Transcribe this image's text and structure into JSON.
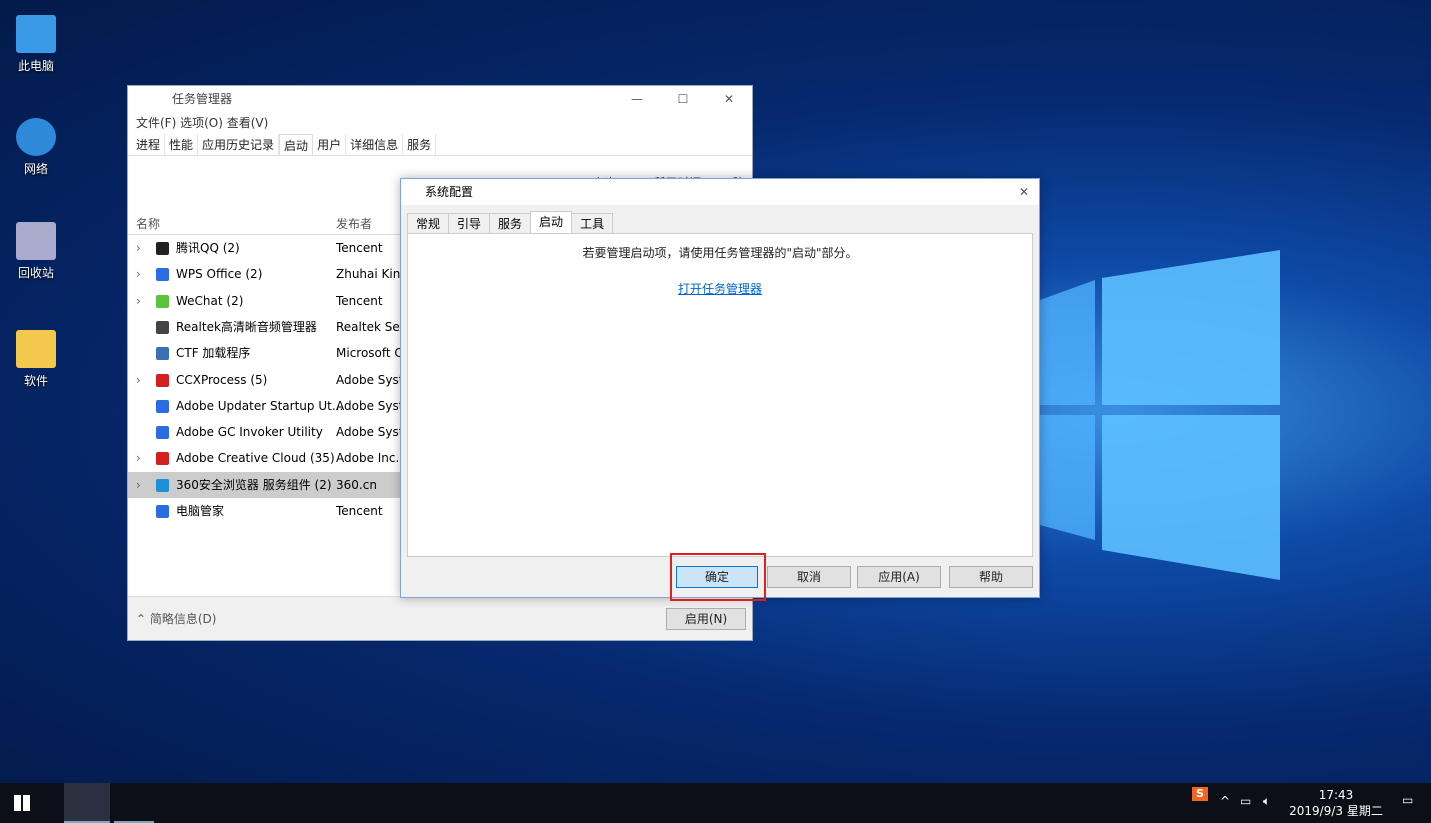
{
  "desktop": {
    "icons": [
      "此电脑",
      "网络",
      "回收站",
      "软件"
    ]
  },
  "task_manager": {
    "title": "任务管理器",
    "menu": [
      "文件(F)",
      "选项(O)",
      "查看(V)"
    ],
    "tabs": [
      "进程",
      "性能",
      "应用历史记录",
      "启动",
      "用户",
      "详细信息",
      "服务"
    ],
    "active_tab": "启动",
    "bios_time": "上次 BIOS 所用时间: 0.0 秒",
    "columns": [
      "名称",
      "发布者"
    ],
    "rows": [
      {
        "name": "腾讯QQ (2)",
        "publisher": "Tencent",
        "expand": true,
        "color": "#222"
      },
      {
        "name": "WPS Office (2)",
        "publisher": "Zhuhai Kingsoft",
        "expand": true,
        "color": "#2a6de0"
      },
      {
        "name": "WeChat (2)",
        "publisher": "Tencent",
        "expand": true,
        "color": "#5ac43a"
      },
      {
        "name": "Realtek高清晰音频管理器",
        "publisher": "Realtek Semiconductor",
        "expand": false,
        "color": "#444"
      },
      {
        "name": "CTF 加载程序",
        "publisher": "Microsoft Corporation",
        "expand": false,
        "color": "#3b6fb6"
      },
      {
        "name": "CCXProcess (5)",
        "publisher": "Adobe Systems",
        "expand": true,
        "color": "#d42020"
      },
      {
        "name": "Adobe Updater Startup Ut...",
        "publisher": "Adobe Systems",
        "expand": false,
        "color": "#2a6de0"
      },
      {
        "name": "Adobe GC Invoker Utility",
        "publisher": "Adobe Systems",
        "expand": false,
        "color": "#2a6de0"
      },
      {
        "name": "Adobe Creative Cloud (35)",
        "publisher": "Adobe Inc.",
        "expand": true,
        "color": "#d42020"
      },
      {
        "name": "360安全浏览器 服务组件 (2)",
        "publisher": "360.cn",
        "expand": true,
        "color": "#1e90d8",
        "selected": true
      },
      {
        "name": "电脑管家",
        "publisher": "Tencent",
        "expand": false,
        "color": "#2a6de0"
      }
    ],
    "less_details": "简略信息(D)",
    "enable_button": "启用(N)"
  },
  "sysconfig": {
    "title": "系统配置",
    "tabs": [
      "常规",
      "引导",
      "服务",
      "启动",
      "工具"
    ],
    "active_tab": "启动",
    "message": "若要管理启动项，请使用任务管理器的\"启动\"部分。",
    "link": "打开任务管理器",
    "buttons": [
      "确定",
      "取消",
      "应用(A)",
      "帮助"
    ]
  },
  "taskbar": {
    "time": "17:43",
    "date": "2019/9/3 星期二",
    "ime": "S"
  }
}
